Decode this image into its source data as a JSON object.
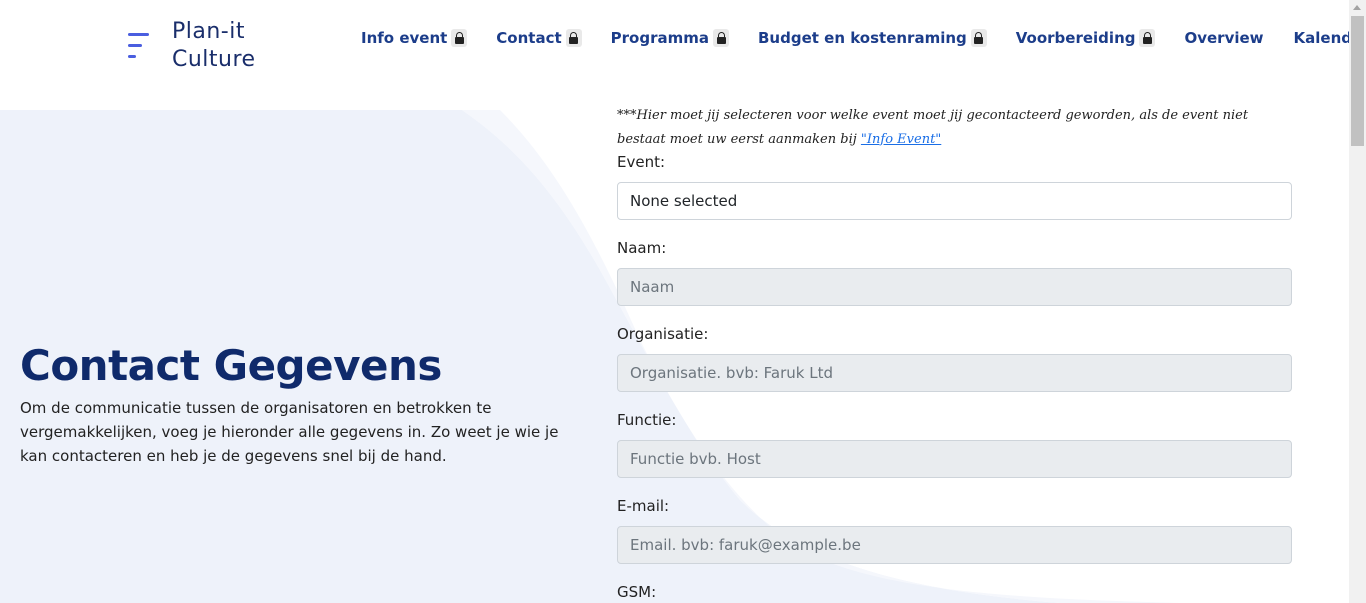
{
  "brand": {
    "line1": "Plan-it",
    "line2": "Culture",
    "icon": "menu-lines-icon",
    "accent": "#4a5ee0"
  },
  "nav": [
    {
      "label": "Info event",
      "locked": true
    },
    {
      "label": "Contact",
      "locked": true
    },
    {
      "label": "Programma",
      "locked": true
    },
    {
      "label": "Budget en kostenraming",
      "locked": true
    },
    {
      "label": "Voorbereiding",
      "locked": true
    },
    {
      "label": "Overview",
      "locked": false
    },
    {
      "label": "Kalendar",
      "locked": false
    }
  ],
  "hero": {
    "title": "Contact Gegevens",
    "text": "Om de communicatie tussen de organisatoren en betrokken te vergemakkelijken, voeg je hieronder alle gegevens in. Zo weet je wie je kan contacteren en heb je de gegevens snel bij de hand."
  },
  "form": {
    "note_text": "***Hier moet jij selecteren voor welke event moet jij gecontacteerd geworden, als de event niet bestaat moet uw eerst aanmaken bij ",
    "note_link": "\"Info Event\"",
    "event_label": "Event:",
    "event_value": "None selected",
    "naam_label": "Naam:",
    "naam_placeholder": "Naam",
    "organisatie_label": "Organisatie:",
    "organisatie_placeholder": "Organisatie. bvb: Faruk Ltd",
    "functie_label": "Functie:",
    "functie_placeholder": "Functie bvb. Host",
    "email_label": "E-mail:",
    "email_placeholder": "Email. bvb: faruk@example.be",
    "gsm_label": "GSM:"
  },
  "colors": {
    "nav_text": "#1c3d8a",
    "hero_title": "#0f2a6b",
    "bg_tint": "#eef2fa",
    "link": "#1a6ee6",
    "disabled_field": "#e9ecef"
  }
}
